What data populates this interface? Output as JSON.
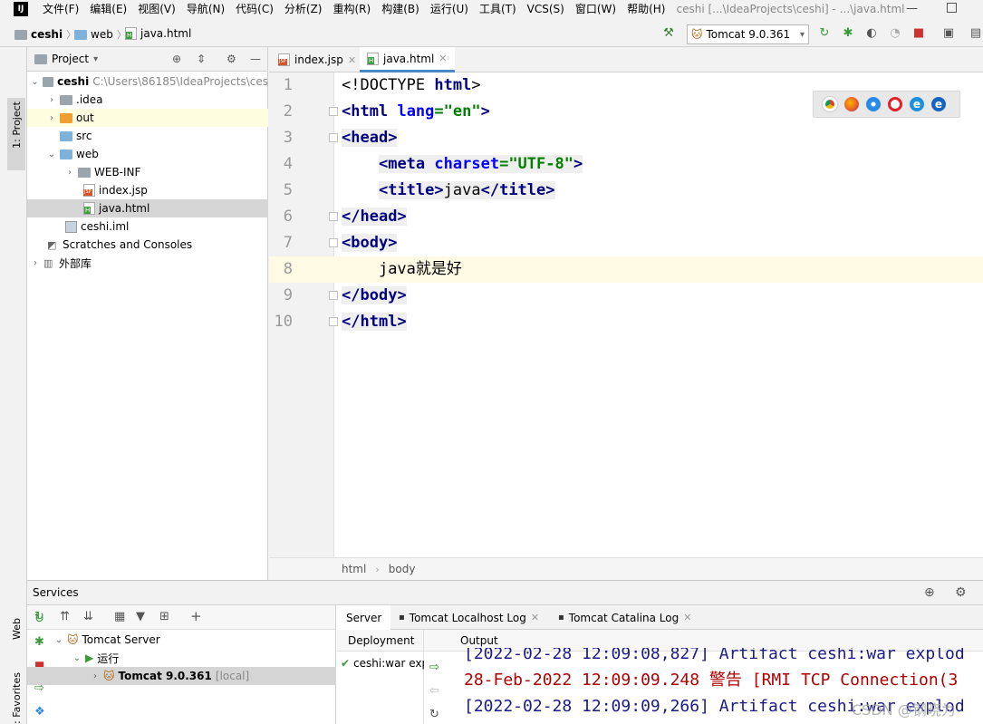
{
  "menubar": {
    "items": [
      "文件(F)",
      "编辑(E)",
      "视图(V)",
      "导航(N)",
      "代码(C)",
      "分析(Z)",
      "重构(R)",
      "构建(B)",
      "运行(U)",
      "工具(T)",
      "VCS(S)",
      "窗口(W)",
      "帮助(H)"
    ],
    "window_title": "ceshi [...\\IdeaProjects\\ceshi] - ...\\java.html"
  },
  "navbar": {
    "crumbs": [
      "ceshi",
      "web",
      "java.html"
    ],
    "run_config": "Tomcat 9.0.361"
  },
  "left_strip": {
    "project_tab": "1: Project",
    "web_tab": "Web",
    "favorites_tab": "2: Favorites"
  },
  "project": {
    "header": "Project",
    "tree": [
      {
        "label": "ceshi",
        "hint": "C:\\Users\\86185\\IdeaProjects\\ces",
        "icon": "folder-icon",
        "bold": true
      },
      {
        "label": ".idea",
        "icon": "folder-icon"
      },
      {
        "label": "out",
        "icon": "folder-orange-icon"
      },
      {
        "label": "src",
        "icon": "folder-blue-icon"
      },
      {
        "label": "web",
        "icon": "folder-blue-icon"
      },
      {
        "label": "WEB-INF",
        "icon": "folder-icon"
      },
      {
        "label": "index.jsp",
        "icon": "jsp-file-icon"
      },
      {
        "label": "java.html",
        "icon": "html-file-icon"
      },
      {
        "label": "ceshi.iml",
        "icon": "iml-file-icon"
      },
      {
        "label": "Scratches and Consoles",
        "icon": "scratches-icon"
      },
      {
        "label": "外部库",
        "icon": "library-icon"
      }
    ]
  },
  "editor": {
    "tabs": [
      {
        "label": "index.jsp"
      },
      {
        "label": "java.html"
      }
    ],
    "line_numbers": [
      "1",
      "2",
      "3",
      "4",
      "5",
      "6",
      "7",
      "8",
      "9",
      "10"
    ],
    "code": {
      "l1": {
        "open": "<!DOCTYPE ",
        "kw": "html",
        "close": ">"
      },
      "l2": {
        "lt": "<",
        "tag": "html",
        "sp": " ",
        "attr": "lang",
        "eq": "=",
        "val": "\"en\"",
        "gt": ">"
      },
      "l3": {
        "lt": "<",
        "tag": "head",
        "gt": ">"
      },
      "l4": {
        "indent": "    ",
        "lt": "<",
        "tag": "meta",
        "sp": " ",
        "attr": "charset",
        "eq": "=",
        "val": "\"UTF-8\"",
        "gt": ">"
      },
      "l5": {
        "indent": "    ",
        "lt": "<",
        "tag": "title",
        "gt": ">",
        "text": "java",
        "lt2": "</",
        "tag2": "title",
        "gt2": ">"
      },
      "l6": {
        "lt": "</",
        "tag": "head",
        "gt": ">"
      },
      "l7": {
        "lt": "<",
        "tag": "body",
        "gt": ">"
      },
      "l8": {
        "indent": "    ",
        "text": "java就是好"
      },
      "l9": {
        "lt": "</",
        "tag": "body",
        "gt": ">"
      },
      "l10": {
        "lt": "</",
        "tag": "html",
        "gt": ">"
      }
    },
    "breadcrumbs": [
      "html",
      "body"
    ]
  },
  "services": {
    "title": "Services",
    "tree": [
      {
        "label": "Tomcat Server"
      },
      {
        "label": "运行"
      },
      {
        "label": "Tomcat 9.0.361",
        "hint": "[local]"
      }
    ],
    "tabs": [
      "Server",
      "Tomcat Localhost Log",
      "Tomcat Catalina Log"
    ],
    "deployment_header": "Deployment",
    "deployment_item": "ceshi:war exp",
    "output_header": "Output",
    "log_lines": [
      "[2022-02-28 12:09:08,827] Artifact ceshi:war explod",
      "28-Feb-2022 12:09:09.248 警告 [RMI TCP Connection(3",
      "[2022-02-28 12:09:09,266] Artifact ceshi:war explod"
    ]
  },
  "watermark": "CSDN @钢晓为",
  "colors": {
    "tag": "#000080",
    "attr": "#0000ff",
    "string": "#008000",
    "current_line": "#fffae3",
    "selection": "#d5d5d5",
    "accent": "#4a88c7"
  }
}
